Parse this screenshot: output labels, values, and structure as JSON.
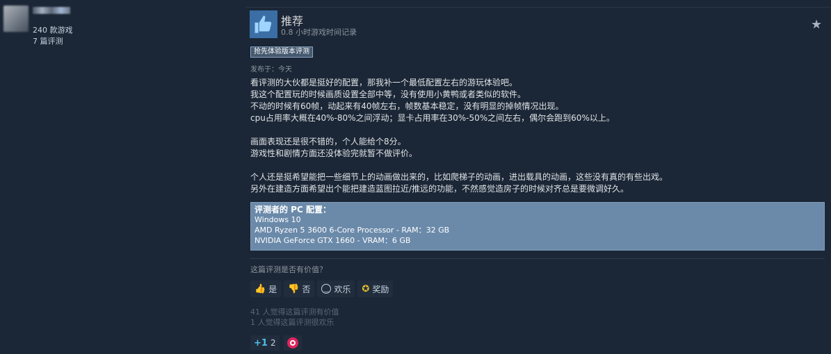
{
  "author": {
    "games_count": "240 款游戏",
    "reviews_count": "7 篇评测"
  },
  "review": {
    "verdict": "推荐",
    "hours": "0.8 小时游戏时间记录",
    "early_access_badge": "抢先体验版本评测",
    "posted": "发布于：今天",
    "paragraphs": [
      "看评测的大伙都是挺好的配置，那我补一个最低配置左右的游玩体验吧。",
      "我这个配置玩的时候画质设置全部中等，没有使用小黄鸭或者类似的软件。",
      "不动的时候有60帧，动起来有40帧左右，帧数基本稳定，没有明显的掉帧情况出现。",
      "cpu占用率大概在40%-80%之间浮动；显卡占用率在30%-50%之间左右，偶尔会跑到60%以上。",
      "",
      "画面表现还是很不错的，个人能给个8分。",
      "游戏性和剧情方面还没体验完就暂不做评价。",
      "",
      "个人还是挺希望能把一些细节上的动画做出来的，比如爬梯子的动画，进出载具的动画，这些没有真的有些出戏。",
      "另外在建造方面希望出个能把建造蓝图拉近/推远的功能，不然感觉造房子的时候对齐总是要微调好久。"
    ],
    "specs": {
      "title": "评测者的 PC 配置：",
      "os": "Windows 10",
      "cpu": "AMD Ryzen 5 3600 6-Core Processor - RAM：32 GB",
      "gpu": "NVIDIA GeForce GTX 1660 - VRAM：6 GB"
    }
  },
  "feedback": {
    "question": "这篇评测是否有价值？",
    "yes_label": "是",
    "no_label": "否",
    "funny_label": "欢乐",
    "award_label": "奖励",
    "helpful_tally": "41 人觉得这篇评测有价值",
    "funny_tally": "1 人觉得这篇评测很欢乐"
  },
  "reactions": {
    "first_count": "2",
    "first_icon": "+1",
    "colors": {
      "accent": "#3a6ea5",
      "specs_bg": "#6b8aaa",
      "award": "#e8c12d",
      "heart": "#e0245e"
    }
  }
}
